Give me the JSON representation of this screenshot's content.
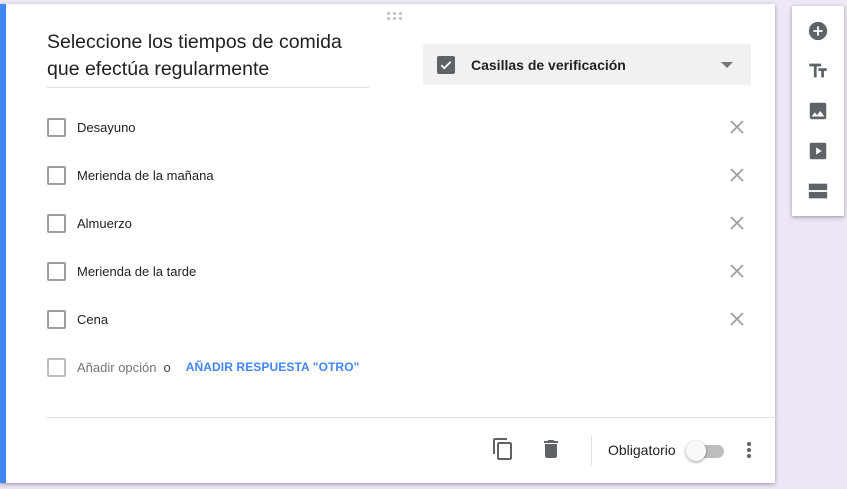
{
  "question": {
    "title": "Seleccione los tiempos de comida que efectúa regularmente",
    "type_label": "Casillas de verificación"
  },
  "options": [
    {
      "label": "Desayuno"
    },
    {
      "label": "Merienda de la mañana"
    },
    {
      "label": "Almuerzo"
    },
    {
      "label": "Merienda de la tarde"
    },
    {
      "label": "Cena"
    }
  ],
  "add_row": {
    "add_option": "Añadir opción",
    "or": "o",
    "add_other": "AÑADIR RESPUESTA \"OTRO\""
  },
  "footer": {
    "required_label": "Obligatorio",
    "required_on": false
  },
  "side_toolbar": {
    "tools": [
      "add-question-icon",
      "add-title-icon",
      "add-image-icon",
      "add-video-icon",
      "add-section-icon"
    ]
  },
  "colors": {
    "accent": "#4285f4",
    "background": "#ede7f6",
    "icon": "#5f6368"
  }
}
